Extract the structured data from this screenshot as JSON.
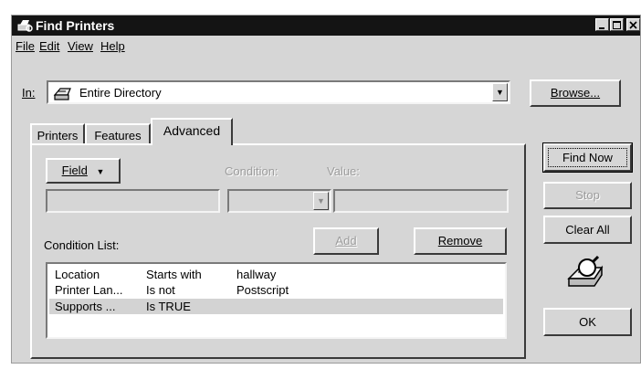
{
  "window": {
    "title": "Find Printers"
  },
  "menu": [
    {
      "label": "File"
    },
    {
      "label": "Edit"
    },
    {
      "label": "View"
    },
    {
      "label": "Help"
    }
  ],
  "in_row": {
    "label": "In:",
    "value": "Entire Directory",
    "icon": "printer-icon",
    "browse_label": "Browse..."
  },
  "tabs": [
    {
      "label": "Printers"
    },
    {
      "label": "Features"
    },
    {
      "label": "Advanced"
    }
  ],
  "advanced": {
    "field_button": "Field",
    "condition_label": "Condition:",
    "value_label": "Value:",
    "condition_list_label": "Condition List:",
    "add_label": "Add",
    "remove_label": "Remove",
    "conditions": [
      {
        "field": "Location",
        "condition": "Starts with",
        "value": "hallway"
      },
      {
        "field": "Printer Lan...",
        "condition": "Is not",
        "value": "Postscript"
      },
      {
        "field": "Supports ...",
        "condition": "Is TRUE",
        "value": ""
      }
    ]
  },
  "side_buttons": {
    "find_now": "Find Now",
    "stop": "Stop",
    "clear_all": "Clear All",
    "ok": "OK"
  },
  "colors": {
    "title_bar": "#141414",
    "dialog_bg": "#d6d6d6",
    "selection": "#d3d3d3"
  }
}
